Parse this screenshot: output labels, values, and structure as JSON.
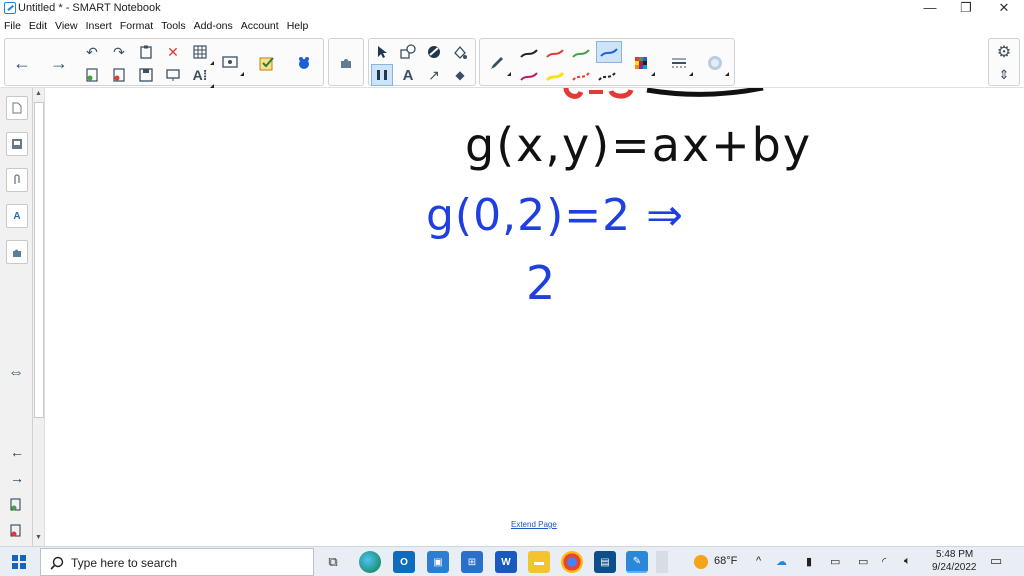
{
  "window": {
    "title": "Untitled * - SMART Notebook",
    "minimize": "—",
    "restore": "❐",
    "close": "✕"
  },
  "menu": [
    "File",
    "Edit",
    "View",
    "Insert",
    "Format",
    "Tools",
    "Add-ons",
    "Account",
    "Help"
  ],
  "toolbar": {
    "back": "←",
    "forward": "→",
    "undo": "↶",
    "redo": "↷",
    "delete": "✕",
    "text_tool": "A",
    "lines": "↗",
    "eraser": "◆",
    "pen_colors": [
      "#222222",
      "#e53935",
      "#43a047",
      "#1e5fd8",
      "#c2185b",
      "#f9e11a",
      "#e53935",
      "#222222"
    ]
  },
  "canvas": {
    "line1": "g(x,y)=ax+by",
    "line2": "g(0,2)=2 ⇒",
    "line3": "2",
    "extend_link": "Extend Page"
  },
  "taskbar": {
    "search_placeholder": "Type here to search",
    "weather": "68°F",
    "time": "5:48 PM",
    "date": "9/24/2022"
  }
}
